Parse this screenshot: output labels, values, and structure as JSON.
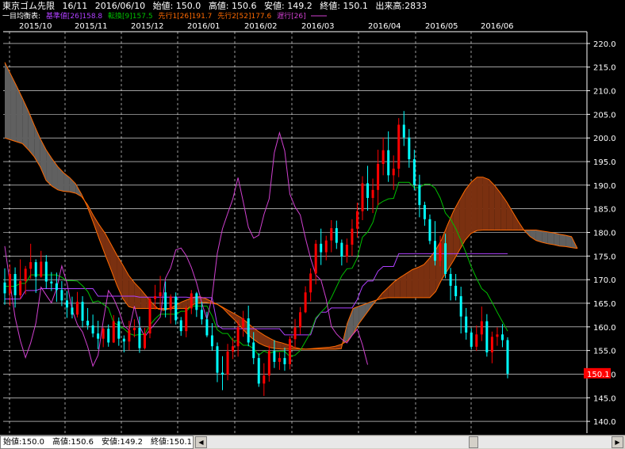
{
  "header": {
    "symbol": "東京ゴム先限",
    "contract": "16/11",
    "date": "2016/06/10",
    "open": "始値: 150.0",
    "high": "高値: 150.6",
    "low": "安値: 149.2",
    "close": "終値: 150.1",
    "volume": "出来高:2833"
  },
  "legend": {
    "title": "一目均衡表:",
    "kijun": "基準値[26]158.8",
    "tenkan": "転換[9]157.5",
    "senko1": "先行1[26]191.7",
    "senko2": "先行2[52]177.6",
    "chikou": "遅行[26]"
  },
  "status": {
    "text": "始値:150.0　高値:150.6　安値:149.2　終値:150.1"
  },
  "colors": {
    "background": "#000000",
    "grid": "#ffffff",
    "up": "#ff0000",
    "down": "#00ffff",
    "kijun": "#b040ff",
    "tenkan": "#00c000",
    "senko1": "#ff6a00",
    "senko2": "#ff6a00",
    "chikou": "#d040d0",
    "cloud_down": "#606060",
    "cloud_up": "#7a3010",
    "price_tag_bg": "#ff0000"
  },
  "chart_data": {
    "type": "candlestick",
    "x_ticks": [
      "2015/10",
      "2015/11",
      "2015/12",
      "2016/01",
      "2016/02",
      "2016/03",
      "2016/04",
      "2016/05",
      "2016/06"
    ],
    "y_ticks": [
      "220.0",
      "215.0",
      "210.0",
      "205.0",
      "200.0",
      "195.0",
      "190.0",
      "185.0",
      "180.0",
      "175.0",
      "170.0",
      "165.0",
      "160.0",
      "155.0",
      "150.0",
      "145.0",
      "140.0"
    ],
    "ylim": [
      137.5,
      222.5
    ],
    "last_price": "150.1",
    "ohlc": [
      [
        169.4,
        172.4,
        164.7,
        167.1
      ],
      [
        167.1,
        173.2,
        164.4,
        171.2
      ],
      [
        171.2,
        172.6,
        164.1,
        166.7
      ],
      [
        166.7,
        174.3,
        165.9,
        169.7
      ],
      [
        169.7,
        172.9,
        166.9,
        172.3
      ],
      [
        172.3,
        177.6,
        170.2,
        173.7
      ],
      [
        173.7,
        174.3,
        167.2,
        170.6
      ],
      [
        170.6,
        176.1,
        170.4,
        173.8
      ],
      [
        173.8,
        175.2,
        168.1,
        169.6
      ],
      [
        169.6,
        171.6,
        167.6,
        169.2
      ],
      [
        169.2,
        171.5,
        165.3,
        167.8
      ],
      [
        167.8,
        169.7,
        164.4,
        165.6
      ],
      [
        165.6,
        167.6,
        161.9,
        164.1
      ],
      [
        164.1,
        166.4,
        161.8,
        162.6
      ],
      [
        162.6,
        167.4,
        162.0,
        165.3
      ],
      [
        165.3,
        166.5,
        159.9,
        161.3
      ],
      [
        161.3,
        164.0,
        159.4,
        160.3
      ],
      [
        160.3,
        162.6,
        157.8,
        158.6
      ],
      [
        158.6,
        161.3,
        155.3,
        157.5
      ],
      [
        157.5,
        159.9,
        155.7,
        159.6
      ],
      [
        159.6,
        160.5,
        155.8,
        156.7
      ],
      [
        156.7,
        162.5,
        156.6,
        161.2
      ],
      [
        161.2,
        162.0,
        156.0,
        157.5
      ],
      [
        157.5,
        158.2,
        154.6,
        156.9
      ],
      [
        156.9,
        161.3,
        155.1,
        159.3
      ],
      [
        159.3,
        161.6,
        157.8,
        159.8
      ],
      [
        159.8,
        162.2,
        154.5,
        155.5
      ],
      [
        155.5,
        159.8,
        155.2,
        158.6
      ],
      [
        158.6,
        166.3,
        157.6,
        165.9
      ],
      [
        165.9,
        168.9,
        163.7,
        166.5
      ],
      [
        166.5,
        170.8,
        163.7,
        167.3
      ],
      [
        167.3,
        169.6,
        162.0,
        163.6
      ],
      [
        163.6,
        166.9,
        160.7,
        166.4
      ],
      [
        166.4,
        167.3,
        160.5,
        161.4
      ],
      [
        161.4,
        162.1,
        158.1,
        159.1
      ],
      [
        159.1,
        164.4,
        157.8,
        163.9
      ],
      [
        163.9,
        167.8,
        162.7,
        167.1
      ],
      [
        167.1,
        167.4,
        162.1,
        163.6
      ],
      [
        163.6,
        165.3,
        160.5,
        161.6
      ],
      [
        161.6,
        163.2,
        157.8,
        158.2
      ],
      [
        158.2,
        160.8,
        155.0,
        155.9
      ],
      [
        155.9,
        156.7,
        148.3,
        150.3
      ],
      [
        150.3,
        153.8,
        146.6,
        149.9
      ],
      [
        149.9,
        156.4,
        148.7,
        154.8
      ],
      [
        154.8,
        157.7,
        153.2,
        155.9
      ],
      [
        155.9,
        161.4,
        153.7,
        159.9
      ],
      [
        159.9,
        163.4,
        157.9,
        161.8
      ],
      [
        161.8,
        164.5,
        155.9,
        156.7
      ],
      [
        156.7,
        158.9,
        152.1,
        153.4
      ],
      [
        153.4,
        154.4,
        147.3,
        148.0
      ],
      [
        148.0,
        152.3,
        145.4,
        149.7
      ],
      [
        149.7,
        156.1,
        148.4,
        154.9
      ],
      [
        154.9,
        157.2,
        151.3,
        152.6
      ],
      [
        152.6,
        154.6,
        150.9,
        153.4
      ],
      [
        153.4,
        155.6,
        150.7,
        152.1
      ],
      [
        152.1,
        158.0,
        151.0,
        157.4
      ],
      [
        157.4,
        161.7,
        155.5,
        159.9
      ],
      [
        159.9,
        164.2,
        158.4,
        163.1
      ],
      [
        163.1,
        168.6,
        162.9,
        167.3
      ],
      [
        167.3,
        172.4,
        165.4,
        171.3
      ],
      [
        171.3,
        178.4,
        169.0,
        177.6
      ],
      [
        177.6,
        180.8,
        173.1,
        175.8
      ],
      [
        175.8,
        179.3,
        174.1,
        178.3
      ],
      [
        178.3,
        182.6,
        175.8,
        180.9
      ],
      [
        180.9,
        182.5,
        176.5,
        177.8
      ],
      [
        177.8,
        178.5,
        173.0,
        174.9
      ],
      [
        174.9,
        178.7,
        173.6,
        177.4
      ],
      [
        177.4,
        182.8,
        175.0,
        180.8
      ],
      [
        180.8,
        186.3,
        178.9,
        184.5
      ],
      [
        184.5,
        191.9,
        182.6,
        190.4
      ],
      [
        190.4,
        194.1,
        184.6,
        187.3
      ],
      [
        187.3,
        191.4,
        184.1,
        189.0
      ],
      [
        189.0,
        197.5,
        185.8,
        194.5
      ],
      [
        194.5,
        200.1,
        192.1,
        197.4
      ],
      [
        197.4,
        201.4,
        190.7,
        192.1
      ],
      [
        192.1,
        196.3,
        189.0,
        193.5
      ],
      [
        193.5,
        204.2,
        191.7,
        202.8
      ],
      [
        202.8,
        205.7,
        198.3,
        200.1
      ],
      [
        200.1,
        201.9,
        193.7,
        195.5
      ],
      [
        195.5,
        197.5,
        188.9,
        190.1
      ],
      [
        190.1,
        192.2,
        183.2,
        185.8
      ],
      [
        185.8,
        186.5,
        181.4,
        182.8
      ],
      [
        182.8,
        183.8,
        177.5,
        178.2
      ],
      [
        178.2,
        182.4,
        173.0,
        174.0
      ],
      [
        174.0,
        179.3,
        172.8,
        177.7
      ],
      [
        177.7,
        179.7,
        170.3,
        171.2
      ],
      [
        171.2,
        172.5,
        165.6,
        168.7
      ],
      [
        168.7,
        171.2,
        165.6,
        166.5
      ],
      [
        166.5,
        168.5,
        158.6,
        162.2
      ],
      [
        162.2,
        164.0,
        157.3,
        158.8
      ],
      [
        158.8,
        159.7,
        155.2,
        155.8
      ],
      [
        155.8,
        160.3,
        154.9,
        158.4
      ],
      [
        158.4,
        164.3,
        157.0,
        161.2
      ],
      [
        161.2,
        162.7,
        153.7,
        154.6
      ],
      [
        154.6,
        159.0,
        152.3,
        157.9
      ],
      [
        157.9,
        159.9,
        156.0,
        158.4
      ],
      [
        158.4,
        160.6,
        155.7,
        157.2
      ],
      [
        157.2,
        157.8,
        149.1,
        150.1
      ]
    ],
    "series": [
      {
        "name": "基準値[26]",
        "values": [
          165.9,
          165.9,
          165.9,
          165.9,
          167.7,
          167.7,
          167.7,
          168.1,
          168.1,
          168.1,
          168.1,
          168.1,
          168.1,
          168.1,
          168.1,
          168.1,
          168.1,
          168.1,
          166.5,
          166.5,
          166.5,
          166.5,
          166.5,
          166.5,
          166.5,
          166.5,
          166.3,
          166.3,
          166.3,
          166.3,
          166.3,
          166.3,
          166.3,
          166.3,
          166.3,
          166.3,
          166.2,
          166.2,
          166.2,
          166.2,
          166.2,
          160.4,
          159.6,
          159.6,
          159.6,
          159.6,
          159.6,
          159.6,
          159.6,
          159.6,
          159.6,
          159.6,
          159.6,
          159.6,
          158.3,
          158.3,
          158.3,
          158.3,
          158.3,
          158.3,
          161.6,
          163.1,
          163.1,
          164.0,
          164.0,
          164.0,
          164.0,
          164.0,
          165.8,
          168.6,
          169.7,
          169.7,
          171.8,
          172.8,
          172.8,
          172.8,
          175.5,
          175.5,
          175.5,
          175.5,
          175.5,
          175.5,
          175.5,
          175.5,
          175.5,
          175.5,
          175.5,
          175.5,
          175.5,
          175.5,
          175.5,
          175.5,
          175.5,
          175.5,
          175.5,
          175.5,
          175.5,
          175.5
        ]
      },
      {
        "name": "転換[9]",
        "values": [
          168.6,
          168.6,
          168.6,
          169.2,
          169.2,
          171.0,
          171.0,
          171.0,
          171.0,
          171.0,
          171.0,
          170.5,
          169.8,
          169.8,
          169.7,
          168.7,
          167.5,
          165.2,
          165.5,
          164.8,
          164.0,
          160.9,
          160.3,
          159.6,
          158.6,
          158.2,
          158.4,
          158.4,
          160.4,
          161.7,
          162.7,
          162.7,
          162.7,
          162.7,
          163.3,
          163.3,
          164.4,
          164.4,
          164.4,
          164.4,
          162.3,
          159.4,
          158.6,
          158.6,
          157.1,
          157.1,
          156.1,
          156.1,
          155.4,
          154.0,
          154.9,
          154.4,
          154.8,
          154.8,
          154.8,
          153.7,
          154.0,
          155.0,
          156.9,
          158.8,
          161.9,
          163.1,
          164.2,
          166.2,
          168.5,
          170.8,
          172.3,
          172.4,
          174.6,
          179.0,
          180.1,
          182.1,
          185.9,
          186.6,
          187.1,
          187.2,
          190.6,
          190.6,
          190.6,
          189.5,
          189.5,
          190.2,
          190.2,
          189.4,
          187.3,
          184.1,
          182.8,
          180.8,
          178.3,
          175.6,
          172.7,
          170.3,
          168.1,
          167.2,
          165.2,
          163.1,
          161.1,
          159.1
        ]
      }
    ],
    "ichimoku_senko1_shifted": [
      200.0,
      199.6,
      199.2,
      198.8,
      197.5,
      196.0,
      193.9,
      191.0,
      189.8,
      189.0,
      188.7,
      188.6,
      188.3,
      187.6,
      185.9,
      183.6,
      181.6,
      179.8,
      177.5,
      175.2,
      173.1,
      170.9,
      169.3,
      168.0,
      166.5,
      165.0,
      163.8,
      163.5,
      163.9,
      164.6,
      165.3,
      165.8,
      166.3,
      166.4,
      166.0,
      165.4,
      164.8,
      164.1,
      163.4,
      162.7,
      162.0,
      161.0,
      159.9,
      159.0,
      158.2,
      157.5,
      156.9,
      156.6,
      156.2,
      155.7,
      155.4,
      155.3,
      155.4,
      155.5,
      155.6,
      155.7,
      155.9,
      156.3,
      157.0,
      158.5,
      160.7,
      162.4,
      164.1,
      165.7,
      167.2,
      168.4,
      169.6,
      170.5,
      171.3,
      172.1,
      172.6,
      173.2,
      174.6,
      176.3,
      178.5,
      181.6,
      184.5,
      186.8,
      189.0,
      190.6,
      191.7,
      191.7,
      191.2,
      189.9,
      188.3,
      186.5,
      184.4,
      182.3,
      180.4,
      179.1,
      178.3,
      177.9,
      177.6,
      177.4,
      177.1,
      177.0,
      176.8,
      176.6
    ],
    "ichimoku_senko2_shifted": [
      216.0,
      213.5,
      211.0,
      208.4,
      205.7,
      202.7,
      199.9,
      197.5,
      195.6,
      193.9,
      192.6,
      191.6,
      190.3,
      188.1,
      185.4,
      182.1,
      178.6,
      175.3,
      172.1,
      168.8,
      166.0,
      164.3,
      163.9,
      163.9,
      163.9,
      163.9,
      163.9,
      163.9,
      163.9,
      163.9,
      163.9,
      163.9,
      164.8,
      165.1,
      165.2,
      165.0,
      164.8,
      163.9,
      162.6,
      161.4,
      160.0,
      158.6,
      157.5,
      156.6,
      156.0,
      155.6,
      155.4,
      155.3,
      155.3,
      155.3,
      155.3,
      155.3,
      155.3,
      155.3,
      155.3,
      155.3,
      155.3,
      155.4,
      160.7,
      163.9,
      164.4,
      164.8,
      165.3,
      165.7,
      166.0,
      166.2,
      166.2,
      166.2,
      166.2,
      166.2,
      166.2,
      166.2,
      166.2,
      167.5,
      170.0,
      172.0,
      174.0,
      176.2,
      178.4,
      179.8,
      180.4,
      180.5,
      180.5,
      180.5,
      180.5,
      180.5,
      180.5,
      180.5,
      180.5,
      180.5,
      180.5,
      180.3,
      180.1,
      179.9,
      179.6,
      179.4,
      179.1,
      176.6
    ],
    "ichimoku_chikou_values": [
      177.1,
      169.3,
      162.0,
      157.1,
      153.5,
      156.6,
      160.8,
      168.4,
      166.7,
      165.1,
      168.1,
      172.9,
      169.3,
      163.6,
      160.5,
      158.9,
      155.8,
      151.7,
      154.0,
      161.3,
      167.7,
      166.0,
      163.5,
      160.2,
      159.3,
      164.4,
      160.2,
      157.9,
      159.4,
      160.7,
      162.1,
      170.3,
      172.5,
      176.3,
      176.7,
      175.1,
      172.6,
      169.3,
      165.1,
      161.6,
      166.4,
      175.6,
      180.8,
      184.0,
      187.1,
      191.6,
      186.5,
      181.1,
      178.8,
      179.4,
      183.8,
      187.1,
      196.9,
      201.1,
      197.3,
      188.1,
      185.4,
      183.7,
      178.8,
      174.5,
      171.0,
      169.9,
      165.9,
      160.1,
      158.5,
      157.4,
      156.6,
      158.2,
      159.5,
      156.2,
      152.0
    ]
  }
}
